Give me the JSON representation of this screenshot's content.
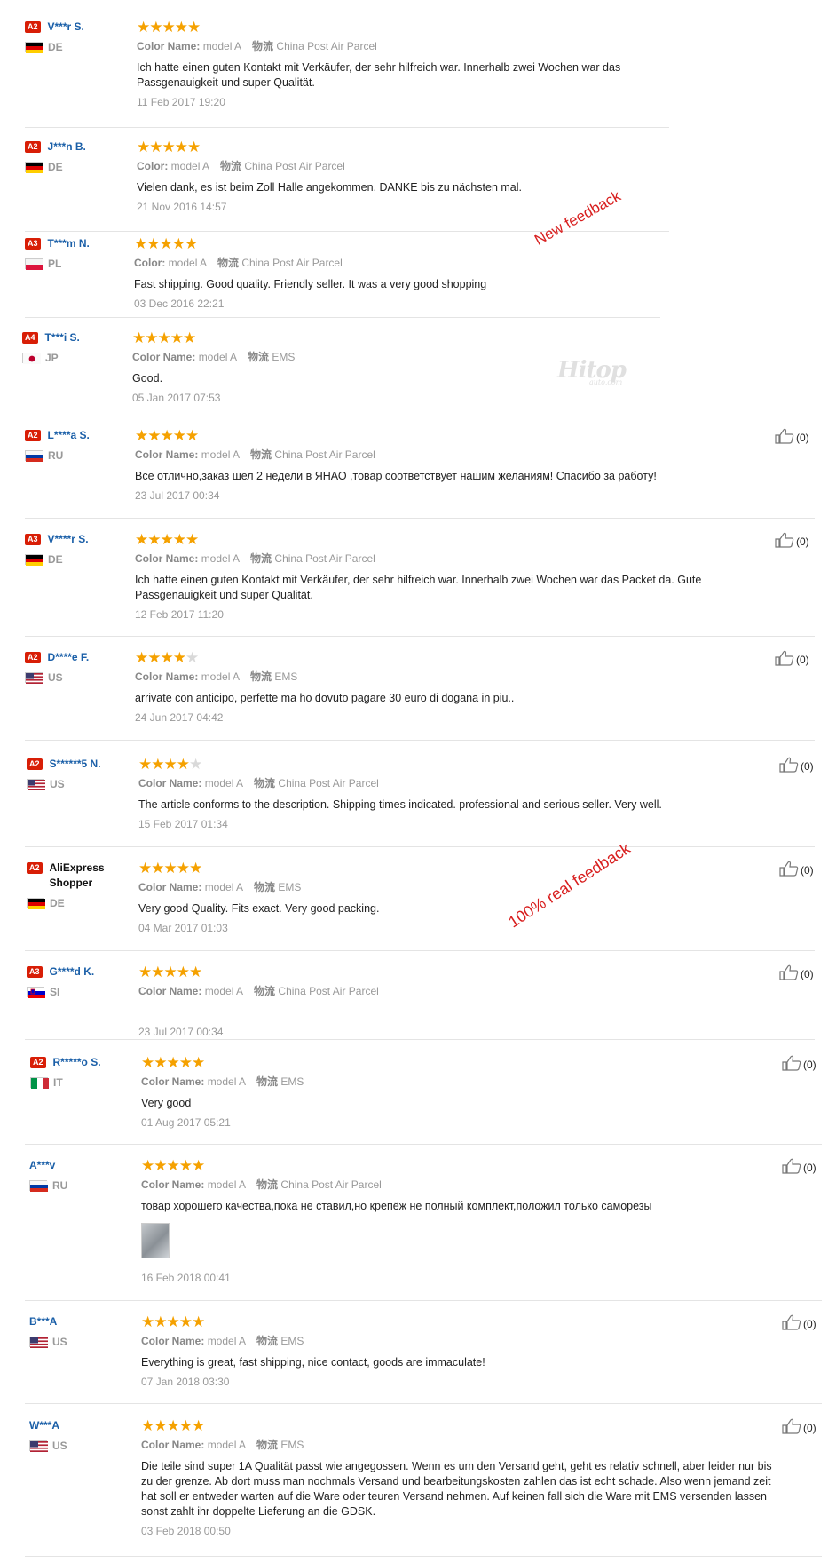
{
  "labels": {
    "color_name": "Color Name:",
    "color": "Color:",
    "shipping": "物流",
    "like_icon": "thumbs-up-icon"
  },
  "annotations": {
    "new_feedback": "New feedback",
    "real_feedback": "100% real feedback"
  },
  "watermark": {
    "brand": "Hitop",
    "sub": "auto.com"
  },
  "reviews": [
    {
      "badge": "A2",
      "user": "V***r S.",
      "country": "DE",
      "stars": 5,
      "color_label": "Color Name:",
      "color": "model A",
      "shipping": "China Post Air Parcel",
      "text": "Ich hatte einen guten Kontakt mit Verkäufer, der sehr hilfreich war. Innerhalb zwei Wochen war das Passgenauigkeit und super Qualität.",
      "date": "11 Feb 2017 19:20"
    },
    {
      "badge": "A2",
      "user": "J***n B.",
      "country": "DE",
      "stars": 5,
      "color_label": "Color:",
      "color": "model A",
      "shipping": "China Post Air Parcel",
      "text": "Vielen dank, es ist beim Zoll Halle angekommen. DANKE bis zu nächsten mal.",
      "date": "21 Nov 2016 14:57"
    },
    {
      "badge": "A3",
      "user": "T***m N.",
      "country": "PL",
      "stars": 5,
      "color_label": "Color:",
      "color": "model A",
      "shipping": "China Post Air Parcel",
      "text": "Fast shipping. Good quality. Friendly seller. It was a very good shopping",
      "date": "03 Dec 2016 22:21"
    },
    {
      "badge": "A4",
      "user": "T***i S.",
      "country": "JP",
      "stars": 5,
      "color_label": "Color Name:",
      "color": "model A",
      "shipping": "EMS",
      "text": "Good.",
      "date": "05 Jan 2017 07:53"
    },
    {
      "badge": "A2",
      "user": "L****a S.",
      "country": "RU",
      "stars": 5,
      "color_label": "Color Name:",
      "color": "model A",
      "shipping": "China Post Air Parcel",
      "text": "Все отлично,заказ шел 2 недели в ЯНАО ,товар соответствует нашим желаниям! Спасибо за работу!",
      "date": "23 Jul 2017 00:34",
      "likes": "(0)"
    },
    {
      "badge": "A3",
      "user": "V****r S.",
      "country": "DE",
      "stars": 5,
      "color_label": "Color Name:",
      "color": "model A",
      "shipping": "China Post Air Parcel",
      "text": "Ich hatte einen guten Kontakt mit Verkäufer, der sehr hilfreich war. Innerhalb zwei Wochen war das Packet da. Gute Passgenauigkeit und super Qualität.",
      "date": "12 Feb 2017 11:20",
      "likes": "(0)"
    },
    {
      "badge": "A2",
      "user": "D****e F.",
      "country": "US",
      "stars": 4,
      "color_label": "Color Name:",
      "color": "model A",
      "shipping": "EMS",
      "text": "arrivate con anticipo, perfette ma ho dovuto pagare 30 euro di dogana in piu..",
      "date": "24 Jun 2017 04:42",
      "likes": "(0)"
    },
    {
      "badge": "A2",
      "user": "S******5 N.",
      "country": "US",
      "stars": 4,
      "color_label": "Color Name:",
      "color": "model A",
      "shipping": "China Post Air Parcel",
      "text": "The article conforms to the description. Shipping times indicated. professional and serious seller. Very well.",
      "date": "15 Feb 2017 01:34",
      "likes": "(0)"
    },
    {
      "badge": "A2",
      "user": "AliExpress Shopper",
      "country": "DE",
      "stars": 5,
      "color_label": "Color Name:",
      "color": "model A",
      "shipping": "EMS",
      "text": "Very good Quality. Fits exact. Very good packing.",
      "date": "04 Mar 2017 01:03",
      "likes": "(0)"
    },
    {
      "badge": "A3",
      "user": "G****d K.",
      "country": "SI",
      "stars": 5,
      "color_label": "Color Name:",
      "color": "model A",
      "shipping": "China Post Air Parcel",
      "text": "",
      "date": "23 Jul 2017 00:34",
      "likes": "(0)"
    },
    {
      "badge": "A2",
      "user": "R*****o S.",
      "country": "IT",
      "stars": 5,
      "color_label": "Color Name:",
      "color": "model A",
      "shipping": "EMS",
      "text": "Very good",
      "date": "01 Aug 2017 05:21",
      "likes": "(0)"
    },
    {
      "badge": "",
      "user": "A***v",
      "country": "RU",
      "stars": 5,
      "color_label": "Color Name:",
      "color": "model A",
      "shipping": "China Post Air Parcel",
      "text": "товар хорошего качества,пока не ставил,но крепёж не полный комплект,положил только саморезы",
      "date": "16 Feb 2018 00:41",
      "likes": "(0)",
      "has_photo": true
    },
    {
      "badge": "",
      "user": "B***A",
      "country": "US",
      "stars": 5,
      "color_label": "Color Name:",
      "color": "model A",
      "shipping": "EMS",
      "text": "Everything is great, fast shipping, nice contact, goods are immaculate!",
      "date": "07 Jan 2018 03:30",
      "likes": "(0)"
    },
    {
      "badge": "",
      "user": "W***A",
      "country": "US",
      "stars": 5,
      "color_label": "Color Name:",
      "color": "model A",
      "shipping": "EMS",
      "text": "Die teile sind super 1A Qualität passt wie angegossen. Wenn es um den Versand geht, geht es relativ schnell, aber leider nur bis zu der grenze. Ab dort muss man nochmals Versand und bearbeitungskosten zahlen das ist echt schade. Also wenn jemand zeit hat soll er entweder warten auf die Ware oder teuren Versand nehmen. Auf keinen fall sich die Ware mit EMS versenden lassen sonst zahlt ihr doppelte Lieferung an die GDSK.",
      "date": "03 Feb 2018 00:50",
      "likes": "(0)"
    }
  ]
}
